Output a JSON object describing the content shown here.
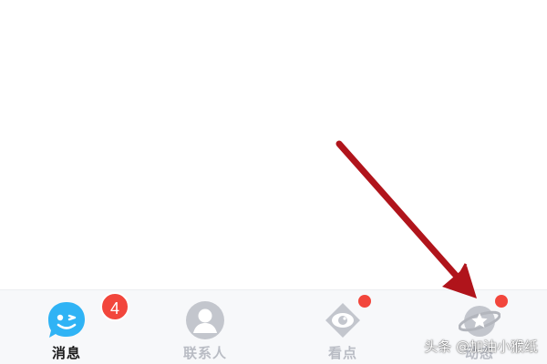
{
  "tab_bar": {
    "tabs": [
      {
        "label": "消息",
        "icon": "messages-smiley-icon",
        "active": true,
        "badge": "4"
      },
      {
        "label": "联系人",
        "icon": "contacts-person-icon",
        "active": false
      },
      {
        "label": "看点",
        "icon": "watch-eye-icon",
        "active": false,
        "dot": true
      },
      {
        "label": "动态",
        "icon": "planet-star-icon",
        "active": false,
        "dot": true
      }
    ]
  },
  "colors": {
    "accent_blue": "#2fb3f5",
    "badge_red": "#f2463c",
    "inactive_grey": "#b9bcc4",
    "arrow_red": "#b0141b"
  },
  "watermark": "头条 @加油小猴纸"
}
